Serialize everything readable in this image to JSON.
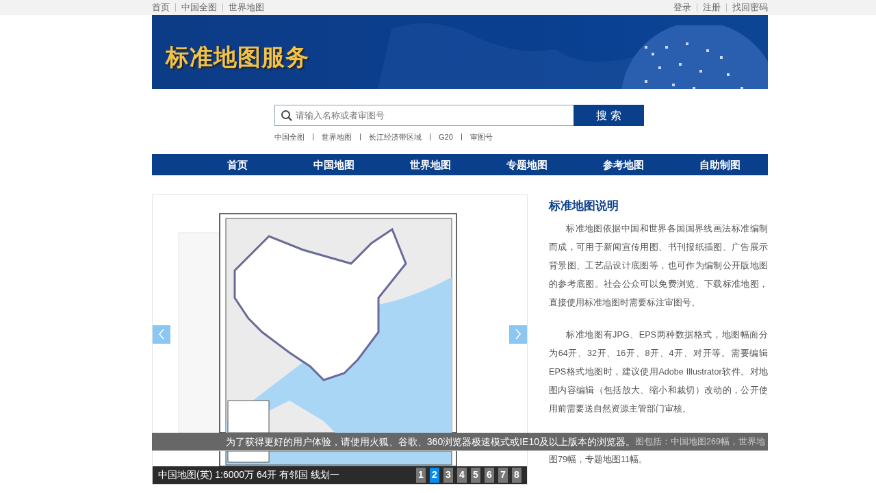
{
  "top_links_left": [
    "首页",
    "中国全图",
    "世界地图"
  ],
  "top_links_right": [
    "登录",
    "注册",
    "找回密码"
  ],
  "banner": {
    "title": "标准地图服务"
  },
  "search": {
    "placeholder": "请输入名称或者审图号",
    "button": "搜 索"
  },
  "quick_links": [
    "中国全图",
    "世界地图",
    "长江经济带区域",
    "G20",
    "审图号"
  ],
  "nav": [
    "首页",
    "中国地图",
    "世界地图",
    "专题地图",
    "参考地图",
    "自助制图"
  ],
  "slider": {
    "caption": "中国地图(英) 1:6000万 64开 有邻国 线划一",
    "pages": [
      {
        "label": "1",
        "selected": false
      },
      {
        "label": "2",
        "selected": true
      },
      {
        "label": "3",
        "selected": false
      },
      {
        "label": "4",
        "selected": false
      },
      {
        "label": "5",
        "selected": false
      },
      {
        "label": "6",
        "selected": false
      },
      {
        "label": "7",
        "selected": false
      },
      {
        "label": "8",
        "selected": false
      }
    ]
  },
  "info": {
    "title": "标准地图说明",
    "paragraphs": [
      "标准地图依据中国和世界各国国界线画法标准编制而成，可用于新闻宣传用图、书刊报纸插图、广告展示背景图、工艺品设计底图等，也可作为编制公开版地图的参考底图。社会公众可以免费浏览、下载标准地图，直接使用标准地图时需要标注审图号。",
      "标准地图有JPG、EPS两种数据格式，地图幅面分为64开、32开、16开、8开、4开、对开等。需要编辑EPS格式地图时，建议使用Adobe Illustrator软件。对地图内容编辑（包括放大、缩小和裁切）改动的，公开使用前需要送自然资源主管部门审核。"
    ],
    "partial_line": "图包括：中国地图269幅，世界地",
    "last_line": "图79幅，专题地图11幅。"
  },
  "notice": "为了获得更好的用户体验，请使用火狐、谷歌、360浏览器极速模式或IE10及以上版本的浏览器。"
}
